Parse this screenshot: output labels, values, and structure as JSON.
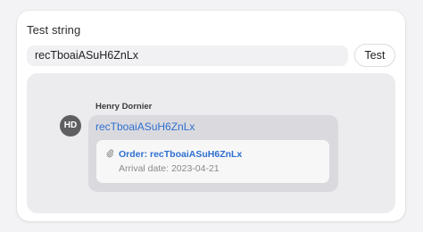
{
  "test_section": {
    "label": "Test string",
    "input_value": "recTboaiASuH6ZnLx",
    "button_label": "Test"
  },
  "preview": {
    "author_name": "Henry Dornier",
    "avatar_initials": "HD",
    "message_link": "recTboaiASuH6ZnLx",
    "attachment": {
      "icon": "paperclip-icon",
      "title": "Order: recTboaiASuH6ZnLx",
      "subtitle": "Arrival date: 2023-04-21"
    }
  },
  "colors": {
    "link": "#2f6fd0",
    "avatar_bg": "#5f5f62",
    "preview_bg": "#ececef",
    "bubble_bg": "#dadade"
  }
}
